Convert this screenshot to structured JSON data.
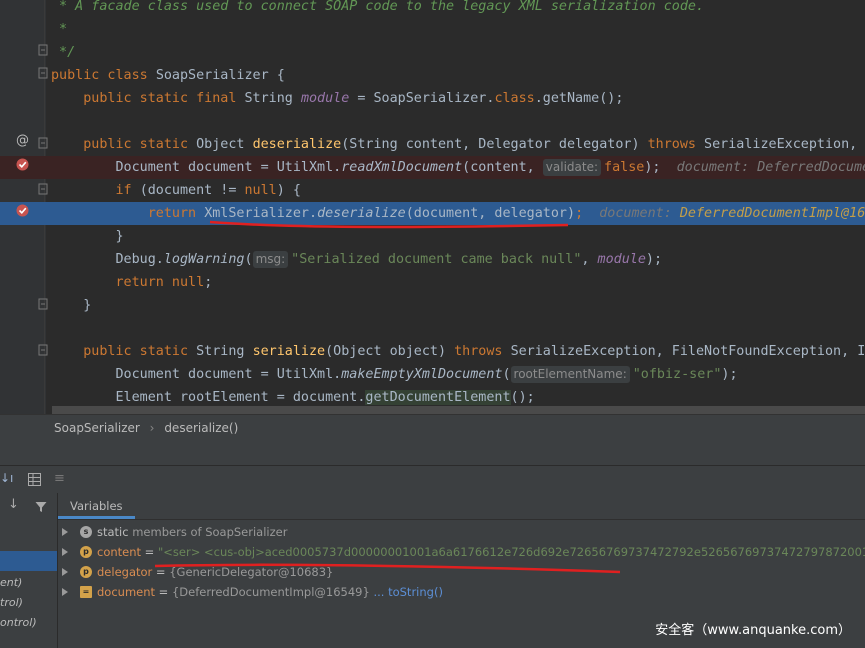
{
  "editor": {
    "lines": [
      {
        "num": "",
        "tokens": [
          [
            "cm",
            " * A facade class used to connect SOAP code to the legacy XML serialization code."
          ]
        ]
      },
      {
        "num": "",
        "tokens": [
          [
            "cm",
            " *"
          ]
        ]
      },
      {
        "num": "",
        "tokens": [
          [
            "cm",
            " */"
          ]
        ]
      },
      {
        "num": "",
        "tokens": [
          [
            "kw",
            "public class "
          ],
          [
            "",
            "SoapSerializer {"
          ]
        ]
      },
      {
        "num": "",
        "tokens": [
          [
            "",
            "    "
          ],
          [
            "kw",
            "public static final "
          ],
          [
            "",
            "String "
          ],
          [
            "fld",
            "module"
          ],
          [
            "",
            " = SoapSerializer."
          ],
          [
            "kw",
            "class"
          ],
          [
            "",
            ".getName();"
          ]
        ]
      },
      {
        "num": "",
        "tokens": []
      },
      {
        "num": "",
        "tokens": [
          [
            "",
            "    "
          ],
          [
            "kw",
            "public static "
          ],
          [
            "",
            "Object "
          ],
          [
            "fn",
            "deserialize"
          ],
          [
            "",
            "(String content, Delegator delegator) "
          ],
          [
            "kw",
            "throws "
          ],
          [
            "",
            "SerializeException, S"
          ]
        ]
      },
      {
        "num": "",
        "tokens": [
          [
            "",
            "        Document document = UtilXml."
          ],
          [
            "it",
            "readXmlDocument"
          ],
          [
            "",
            "(content, "
          ],
          [
            "hint",
            "validate:"
          ],
          [
            "kw",
            "false"
          ],
          [
            "",
            ");  "
          ],
          [
            "inl",
            "document: DeferredDocume"
          ]
        ]
      },
      {
        "num": "",
        "tokens": [
          [
            "",
            "        "
          ],
          [
            "kw",
            "if "
          ],
          [
            "",
            "(document != "
          ],
          [
            "kw",
            "null"
          ],
          [
            "",
            ") {"
          ]
        ]
      },
      {
        "num": "",
        "tokens": [
          [
            "",
            "            "
          ],
          [
            "kw",
            "return "
          ],
          [
            "",
            "XmlSerializer."
          ],
          [
            "it",
            "deserialize"
          ],
          [
            "",
            "(document, delegator)"
          ],
          [
            "kw",
            ";"
          ],
          [
            "",
            "  "
          ],
          [
            "inl",
            "document: "
          ],
          [
            "inlv",
            "DeferredDocumentImpl@165"
          ]
        ]
      },
      {
        "num": "",
        "tokens": [
          [
            "",
            "        }"
          ]
        ]
      },
      {
        "num": "",
        "tokens": [
          [
            "",
            "        Debug."
          ],
          [
            "it",
            "logWarning"
          ],
          [
            "",
            "("
          ],
          [
            "hint",
            "msg:"
          ],
          [
            "str",
            "\"Serialized document came back null\""
          ],
          [
            "",
            ", "
          ],
          [
            "fld",
            "module"
          ],
          [
            "",
            ");"
          ]
        ]
      },
      {
        "num": "",
        "tokens": [
          [
            "",
            "        "
          ],
          [
            "kw",
            "return null"
          ],
          [
            "",
            ";"
          ]
        ]
      },
      {
        "num": "",
        "tokens": [
          [
            "",
            "    }"
          ]
        ]
      },
      {
        "num": "",
        "tokens": []
      },
      {
        "num": "",
        "tokens": [
          [
            "",
            "    "
          ],
          [
            "kw",
            "public static "
          ],
          [
            "",
            "String "
          ],
          [
            "fn",
            "serialize"
          ],
          [
            "",
            "(Object object) "
          ],
          [
            "kw",
            "throws "
          ],
          [
            "",
            "SerializeException, FileNotFoundException, IO"
          ]
        ]
      },
      {
        "num": "",
        "tokens": [
          [
            "",
            "        Document document = UtilXml."
          ],
          [
            "it",
            "makeEmptyXmlDocument"
          ],
          [
            "",
            "("
          ],
          [
            "hint",
            "rootElementName:"
          ],
          [
            "str",
            "\"ofbiz-ser\""
          ],
          [
            "",
            ");"
          ]
        ]
      },
      {
        "num": "",
        "tokens": [
          [
            "",
            "        Element rootElement = document."
          ],
          [
            "hl",
            "getDocumentElement"
          ],
          [
            "",
            "();"
          ]
        ]
      }
    ]
  },
  "breadcrumb": {
    "class_name": "SoapSerializer",
    "method_name": "deserialize()"
  },
  "variables": {
    "tab_label": "Variables",
    "rows": [
      {
        "badge": "s",
        "badge_color": "#a6a6a6",
        "name": "static",
        "rest": " members of SoapSerializer"
      },
      {
        "badge": "p",
        "badge_color": "#d3a24a",
        "name": "content",
        "eq": " = ",
        "value": "\"<ser> <cus-obj>aced0005737d00000001001a6a6176612e726d692e72656769737472792e526567697374727978720017"
      },
      {
        "badge": "p",
        "badge_color": "#d3a24a",
        "name": "delegator",
        "eq": " = ",
        "value": "{GenericDelegator@10683}"
      },
      {
        "badge": "=",
        "badge_color": "#d3a24a",
        "name": "document",
        "eq": " = ",
        "value": "{DeferredDocumentImpl@16549}",
        "link": "... toString()"
      }
    ]
  },
  "frames": [
    "ent)",
    "trol)",
    "ontrol)"
  ],
  "watermark": "安全客（www.anquanke.com）"
}
